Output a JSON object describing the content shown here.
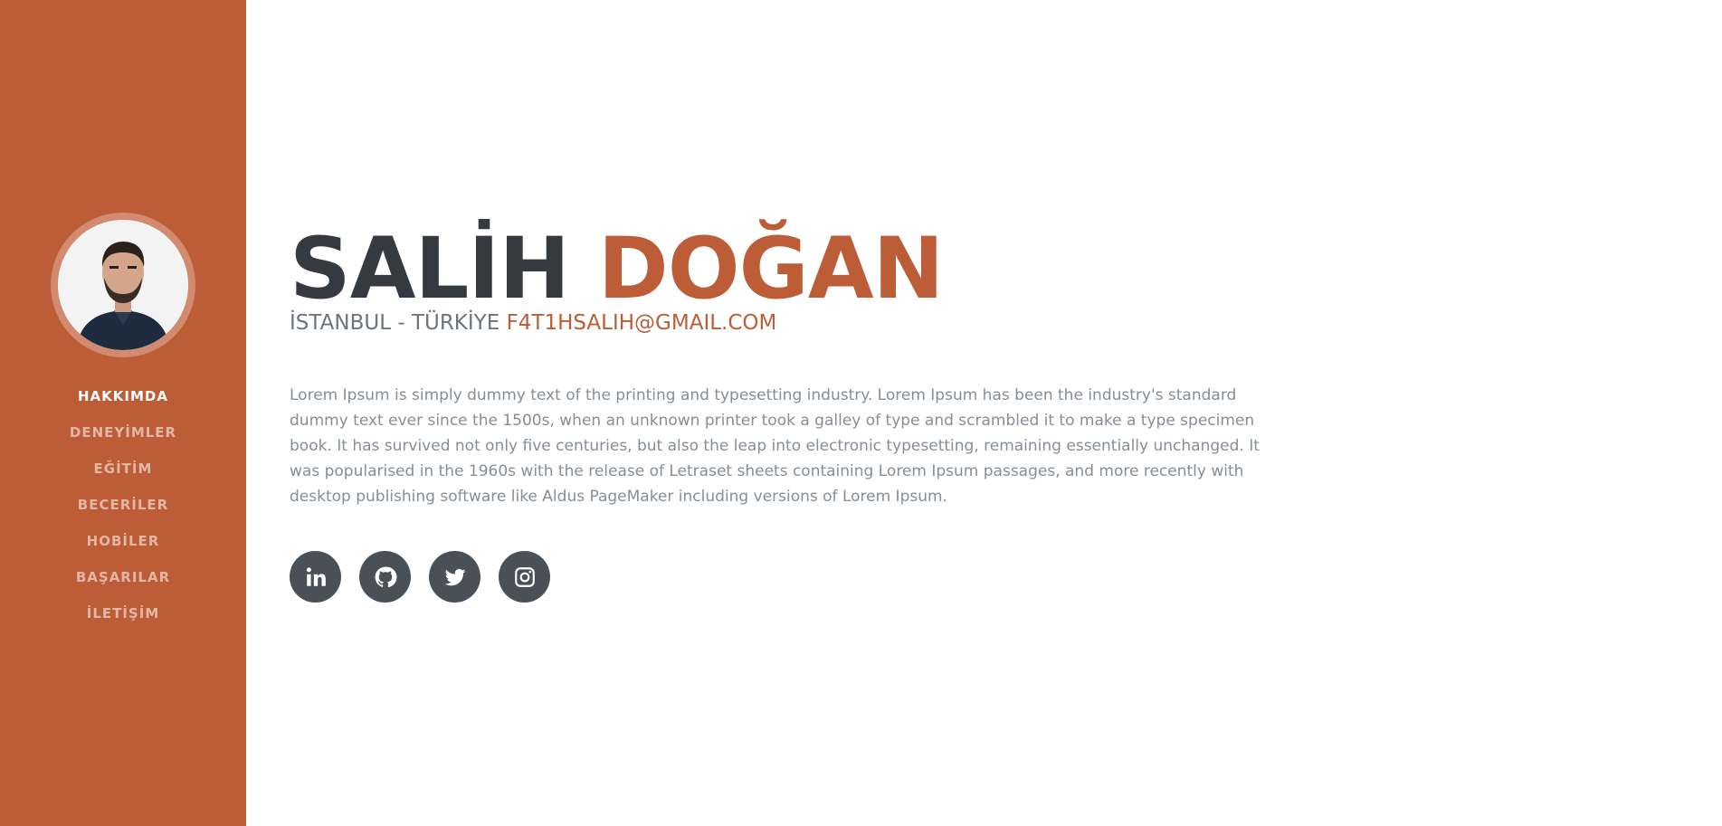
{
  "sidebar": {
    "profile_image": "profile-photo",
    "nav": [
      {
        "label": "HAKKIMDA",
        "active": true
      },
      {
        "label": "DENEYİMLER",
        "active": false
      },
      {
        "label": "EĞİTİM",
        "active": false
      },
      {
        "label": "BECERİLER",
        "active": false
      },
      {
        "label": "HOBİLER",
        "active": false
      },
      {
        "label": "BAŞARILAR",
        "active": false
      },
      {
        "label": "İLETİŞİM",
        "active": false
      }
    ]
  },
  "about": {
    "first_name": "SALİH",
    "last_name": "DOĞAN",
    "location": "İSTANBUL - TÜRKİYE",
    "email": "F4T1HSALIH@GMAIL.COM",
    "description": "Lorem Ipsum is simply dummy text of the printing and typesetting industry. Lorem Ipsum has been the industry's standard dummy text ever since the 1500s, when an unknown printer took a galley of type and scrambled it to make a type specimen book. It has survived not only five centuries, but also the leap into electronic typesetting, remaining essentially unchanged. It was popularised in the 1960s with the release of Letraset sheets containing Lorem Ipsum passages, and more recently with desktop publishing software like Aldus PageMaker including versions of Lorem Ipsum."
  },
  "social": [
    {
      "icon": "linkedin-icon"
    },
    {
      "icon": "github-icon"
    },
    {
      "icon": "twitter-icon"
    },
    {
      "icon": "instagram-icon"
    }
  ],
  "colors": {
    "primary": "#bd5d38",
    "heading": "#343a40",
    "muted": "#6c757d",
    "social_bg": "#495057"
  }
}
